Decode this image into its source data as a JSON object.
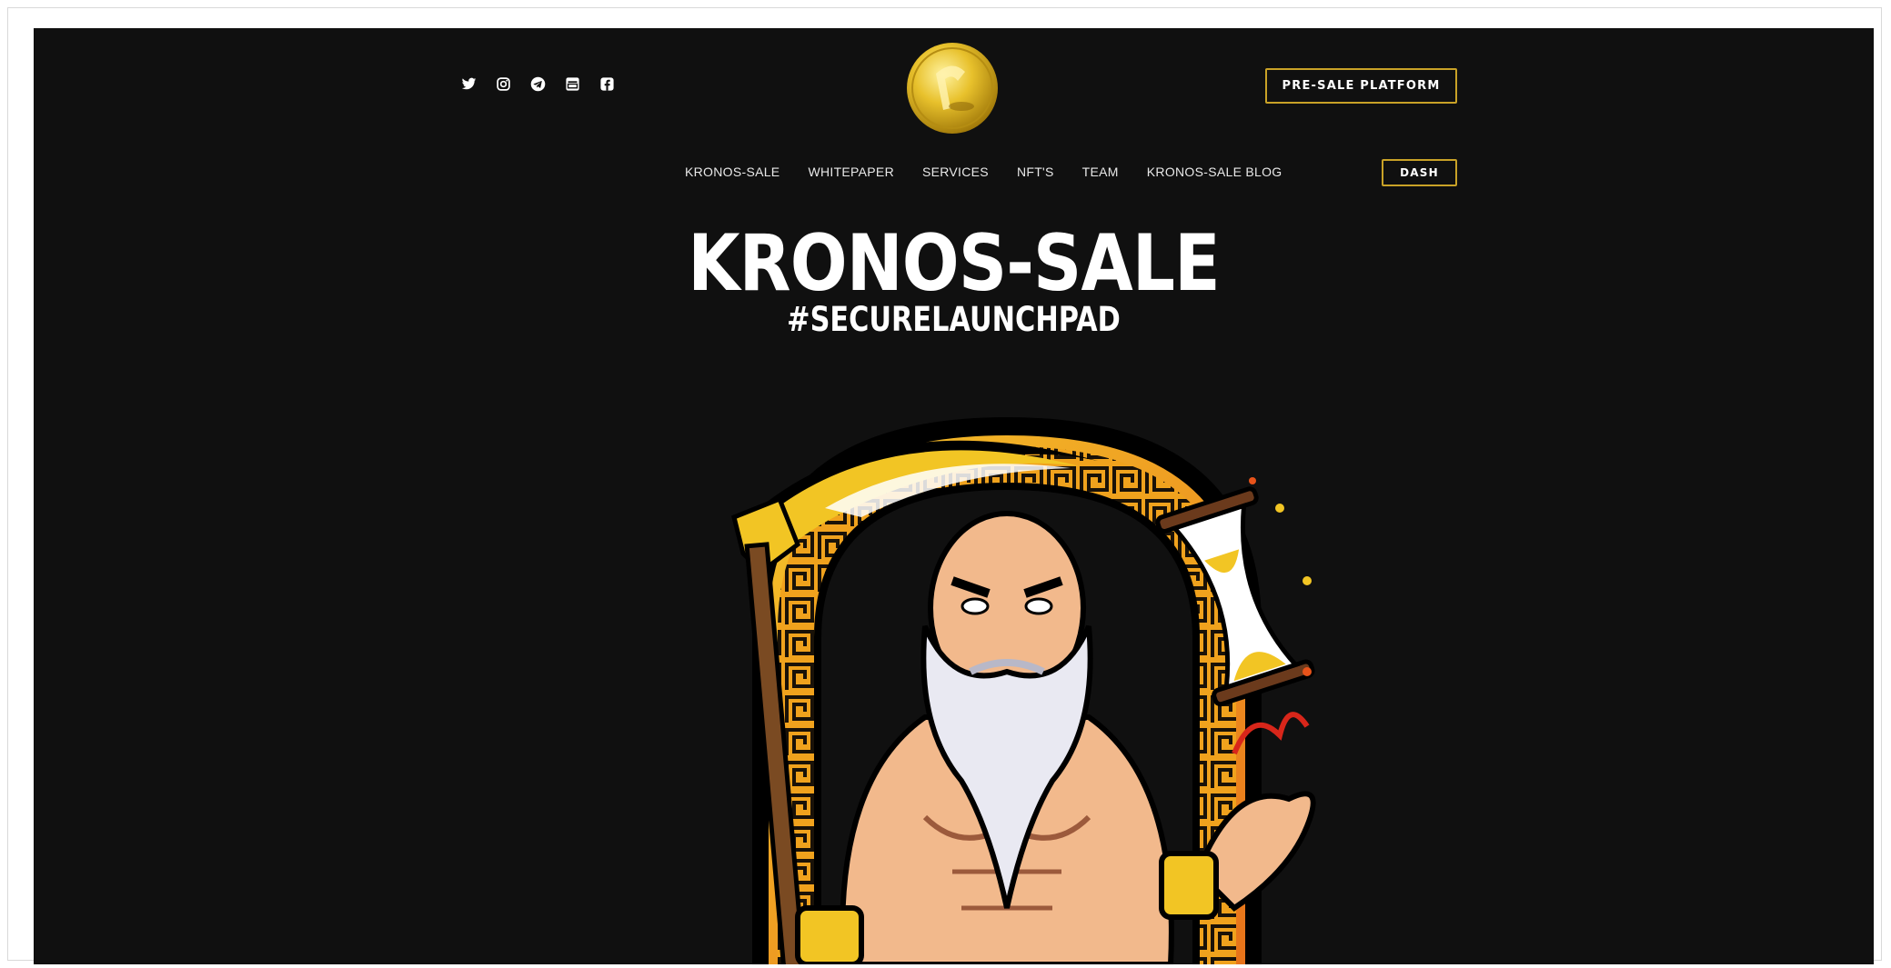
{
  "header": {
    "socials": [
      {
        "icon": "twitter-icon"
      },
      {
        "icon": "instagram-icon"
      },
      {
        "icon": "telegram-icon"
      },
      {
        "icon": "medium-icon"
      },
      {
        "icon": "facebook-icon"
      }
    ],
    "presale_button": "PRE-SALE PLATFORM",
    "dash_button": "DASH",
    "logo_icon": "kronos-coin-logo"
  },
  "nav": {
    "items": [
      {
        "label": "KRONOS-SALE"
      },
      {
        "label": "WHITEPAPER"
      },
      {
        "label": "SERVICES"
      },
      {
        "label": "NFT'S"
      },
      {
        "label": "TEAM"
      },
      {
        "label": "KRONOS-SALE BLOG"
      }
    ]
  },
  "hero": {
    "title": "KRONOS-SALE",
    "subtitle": "#SECURELAUNCHPAD"
  },
  "colors": {
    "background": "#101010",
    "accent_gold": "#c9a227",
    "text": "#ffffff"
  }
}
